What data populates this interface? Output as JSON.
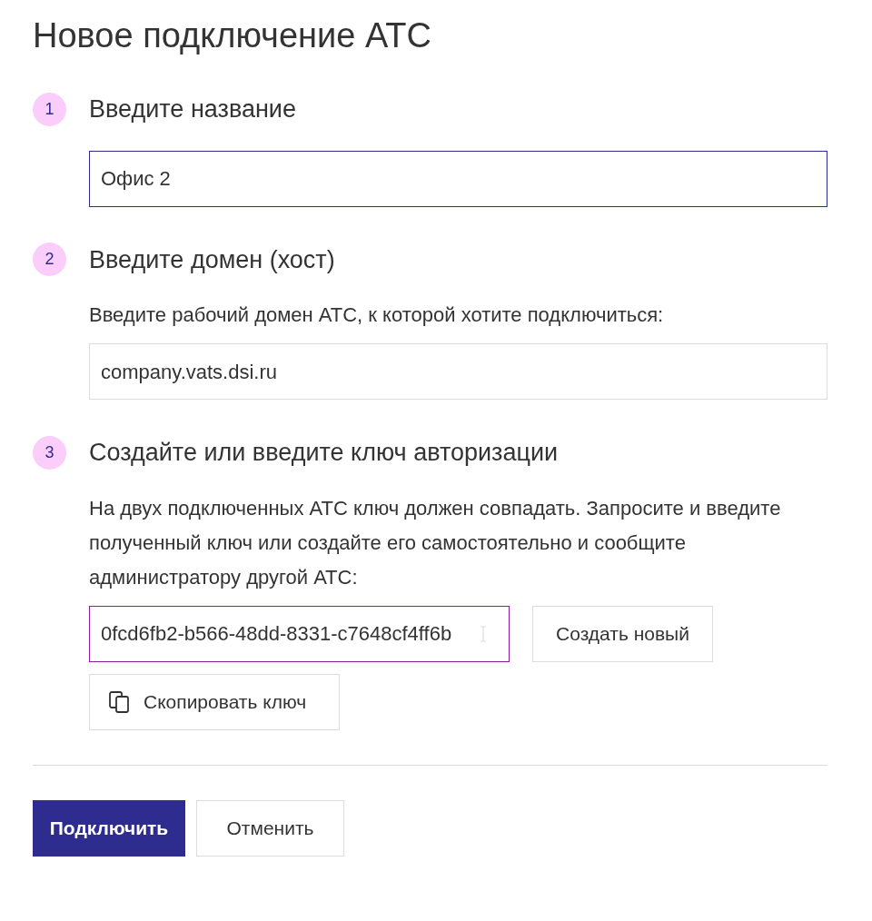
{
  "title": "Новое подключение АТС",
  "steps": [
    {
      "number": "1",
      "heading": "Введите название",
      "field": {
        "value": "Офис 2",
        "focused": true,
        "hovered": false
      }
    },
    {
      "number": "2",
      "heading": "Введите домен (хост)",
      "description": "Введите рабочий домен АТС, к которой хотите подключиться:",
      "field": {
        "value": "company.vats.dsi.ru",
        "focused": false,
        "hovered": false
      }
    },
    {
      "number": "3",
      "heading": "Создайте или введите ключ авторизации",
      "description": "На двух подключенных АТС ключ должен совпадать. Запросите и введите полученный ключ или создайте его самостоятельно и сообщите администратору другой АТС:",
      "field": {
        "value": "0fcd6fb2-b566-48dd-8331-c7648cf4ff6b",
        "focused": false,
        "hovered": true
      },
      "generate_button": "Создать новый",
      "copy_button": "Скопировать ключ"
    }
  ],
  "actions": [
    {
      "label": "Подключить",
      "kind": "primary"
    },
    {
      "label": "Отменить",
      "kind": "secondary"
    }
  ]
}
